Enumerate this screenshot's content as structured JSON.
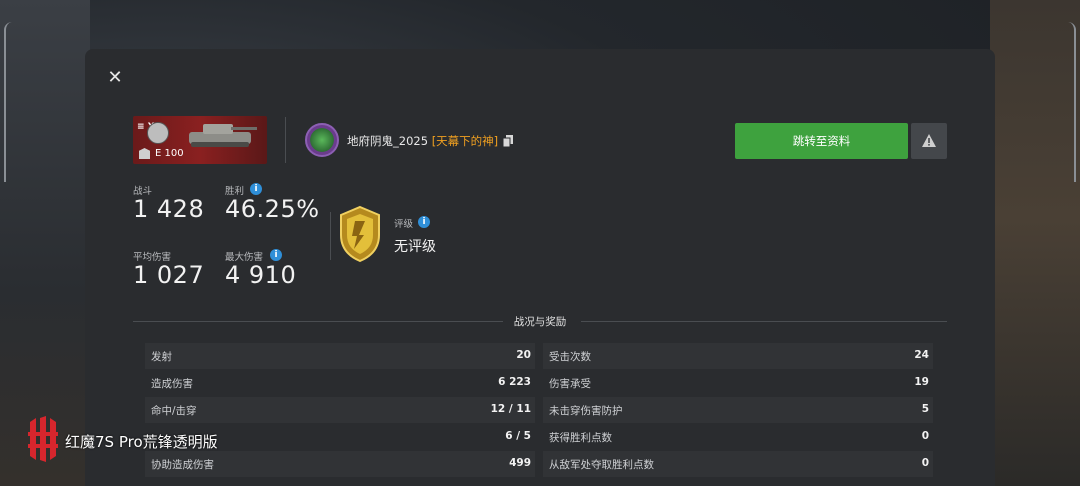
{
  "tank": {
    "tier_roman": "≡ X",
    "name": "E 100"
  },
  "player": {
    "name": "地府阴鬼_2025",
    "clan_tag": "[天幕下的神]"
  },
  "buttons": {
    "profile_label": "跳转至资料"
  },
  "stats": {
    "battles_label": "战斗",
    "battles_value": "1 428",
    "winrate_label": "胜利",
    "winrate_value": "46.25%",
    "avg_damage_label": "平均伤害",
    "avg_damage_value": "1 027",
    "max_damage_label": "最大伤害",
    "max_damage_value": "4 910"
  },
  "rank": {
    "label": "评级",
    "value": "无评级"
  },
  "section_title": "战况与奖励",
  "left_rows": [
    {
      "label": "发射",
      "value": "20"
    },
    {
      "label": "造成伤害",
      "value": "6 223"
    },
    {
      "label": "命中/击穿",
      "value": "12 / 11"
    },
    {
      "label": "",
      "value": "6 / 5"
    },
    {
      "label": "协助造成伤害",
      "value": "499"
    }
  ],
  "right_rows": [
    {
      "label": "受击次数",
      "value": "24"
    },
    {
      "label": "伤害承受",
      "value": "19"
    },
    {
      "label": "未击穿伤害防护",
      "value": "5"
    },
    {
      "label": "获得胜利点数",
      "value": "0"
    },
    {
      "label": "从敌军处夺取胜利点数",
      "value": "0"
    }
  ],
  "watermark": {
    "text": "红魔7S Pro荒锋透明版"
  },
  "colors": {
    "accent_green": "#3ea23e",
    "clan_tag": "#f0a020",
    "info_blue": "#2f8fd8"
  }
}
